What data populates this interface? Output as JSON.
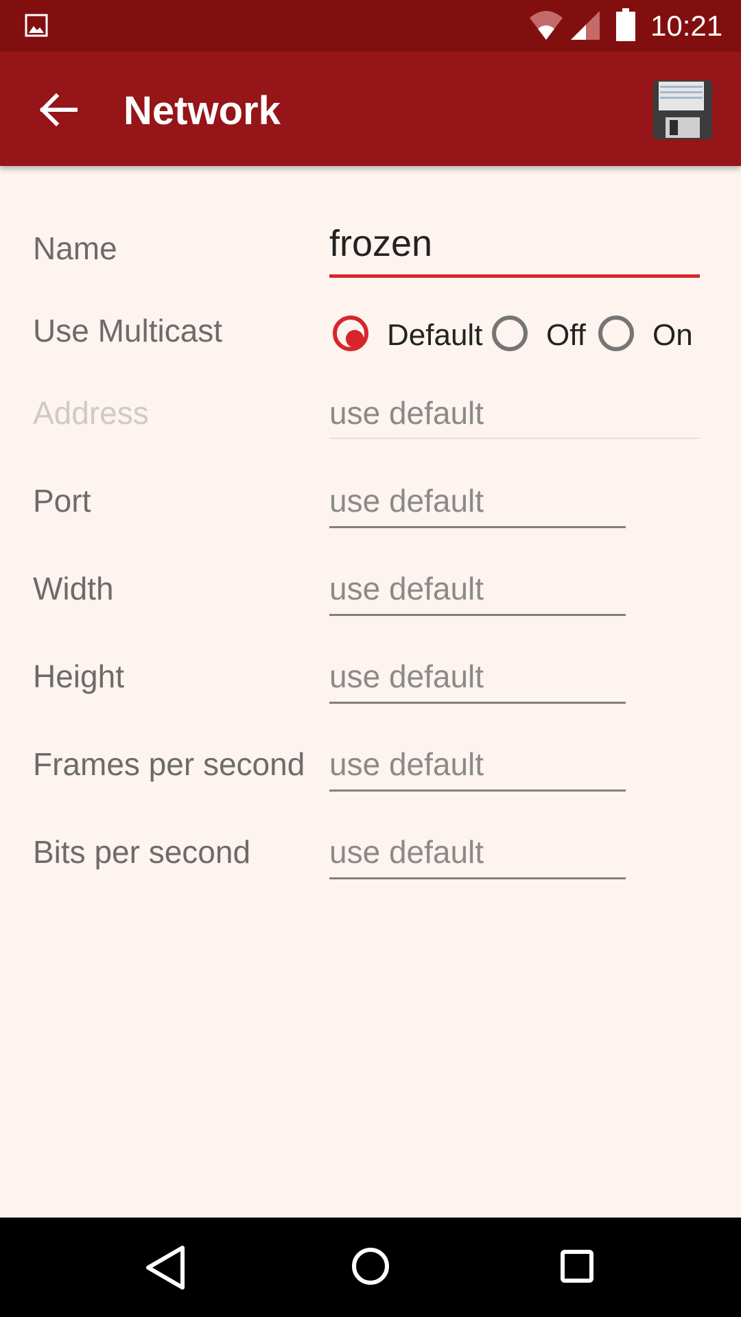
{
  "status_bar": {
    "time": "10:21",
    "icons": [
      "image-notification-icon",
      "wifi-icon",
      "cell-signal-icon",
      "battery-icon"
    ]
  },
  "app_bar": {
    "title": "Network",
    "back_icon": "arrow-left-icon",
    "save_icon": "floppy-disk-icon",
    "color": "#951518"
  },
  "form": {
    "name": {
      "label": "Name",
      "value": "frozen"
    },
    "multicast": {
      "label": "Use Multicast",
      "options": [
        "Default",
        "Off",
        "On"
      ],
      "selected": "Default"
    },
    "address": {
      "label": "Address",
      "placeholder": "use default",
      "disabled": true
    },
    "port": {
      "label": "Port",
      "placeholder": "use default"
    },
    "width": {
      "label": "Width",
      "placeholder": "use default"
    },
    "height": {
      "label": "Height",
      "placeholder": "use default"
    },
    "fps": {
      "label": "Frames per second",
      "placeholder": "use default"
    },
    "bps": {
      "label": "Bits per second",
      "placeholder": "use default"
    }
  },
  "accent_color": "#d7262b",
  "nav_bar": {
    "buttons": [
      "nav-back-icon",
      "nav-home-icon",
      "nav-recents-icon"
    ]
  }
}
